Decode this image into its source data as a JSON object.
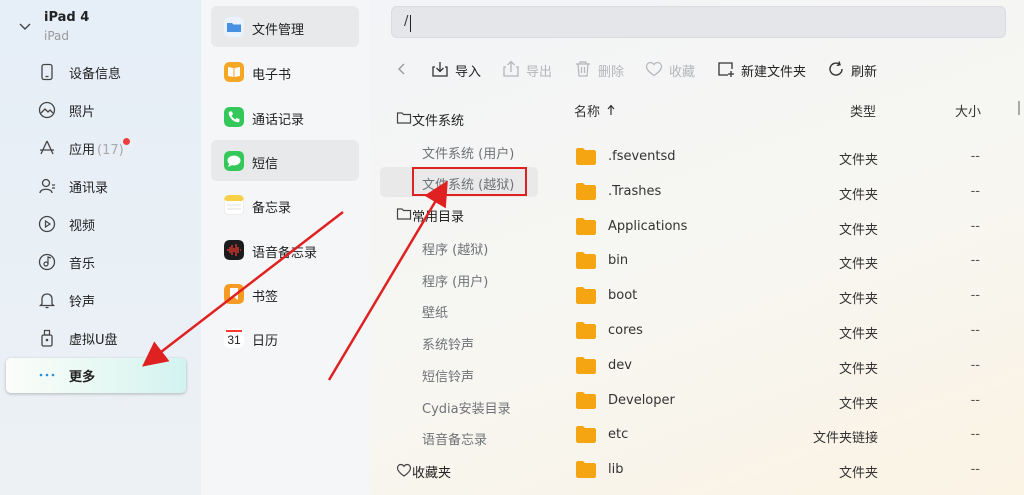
{
  "device": {
    "name": "iPad 4",
    "type": "iPad"
  },
  "sidebar": {
    "items": [
      {
        "label": "设备信息",
        "icon": "phone-icon"
      },
      {
        "label": "照片",
        "icon": "photo-icon"
      },
      {
        "label": "应用",
        "count": "(17)",
        "icon": "apps-icon",
        "badge": true
      },
      {
        "label": "通讯录",
        "icon": "contacts-icon"
      },
      {
        "label": "视频",
        "icon": "video-icon"
      },
      {
        "label": "音乐",
        "icon": "music-icon"
      },
      {
        "label": "铃声",
        "icon": "bell-icon"
      },
      {
        "label": "虚拟U盘",
        "icon": "usb-icon"
      },
      {
        "label": "更多",
        "icon": "more-icon",
        "active": true
      }
    ]
  },
  "apps": {
    "items": [
      {
        "label": "文件管理",
        "icon": "folder-app-icon",
        "color": "#4a90e2"
      },
      {
        "label": "电子书",
        "icon": "book-app-icon",
        "color": "#f5a623"
      },
      {
        "label": "通话记录",
        "icon": "phone-app-icon",
        "color": "#34c759"
      },
      {
        "label": "短信",
        "icon": "message-app-icon",
        "color": "#34c759"
      },
      {
        "label": "备忘录",
        "icon": "notes-app-icon",
        "color": "#f7d046"
      },
      {
        "label": "语音备忘录",
        "icon": "voice-memo-app-icon",
        "color": "#1c1c1e"
      },
      {
        "label": "书签",
        "icon": "bookmark-app-icon",
        "color": "#f59b23"
      },
      {
        "label": "日历",
        "icon": "calendar-app-icon",
        "day": "31"
      }
    ]
  },
  "path": {
    "value": "/"
  },
  "toolbar": {
    "import": "导入",
    "export": "导出",
    "delete": "删除",
    "favorite": "收藏",
    "new_folder": "新建文件夹",
    "refresh": "刷新"
  },
  "tree": {
    "filesystem": "文件系统",
    "fs_user": "文件系统 (用户)",
    "fs_jailbreak": "文件系统 (越狱)",
    "common_dirs": "常用目录",
    "children": [
      "程序 (越狱)",
      "程序 (用户)",
      "壁纸",
      "系统铃声",
      "短信铃声",
      "Cydia安装目录",
      "语音备忘录"
    ],
    "favorites": "收藏夹"
  },
  "table": {
    "headers": {
      "name": "名称",
      "type": "类型",
      "size": "大小"
    },
    "rows": [
      {
        "name": ".fseventsd",
        "type": "文件夹",
        "size": "--"
      },
      {
        "name": ".Trashes",
        "type": "文件夹",
        "size": "--"
      },
      {
        "name": "Applications",
        "type": "文件夹",
        "size": "--"
      },
      {
        "name": "bin",
        "type": "文件夹",
        "size": "--"
      },
      {
        "name": "boot",
        "type": "文件夹",
        "size": "--"
      },
      {
        "name": "cores",
        "type": "文件夹",
        "size": "--"
      },
      {
        "name": "dev",
        "type": "文件夹",
        "size": "--"
      },
      {
        "name": "Developer",
        "type": "文件夹",
        "size": "--"
      },
      {
        "name": "etc",
        "type": "文件夹链接",
        "size": "--"
      },
      {
        "name": "lib",
        "type": "文件夹",
        "size": "--"
      }
    ]
  },
  "colors": {
    "folder": "#f5a511",
    "annotation": "#e02121",
    "accent_active": "#d2f3f0"
  }
}
